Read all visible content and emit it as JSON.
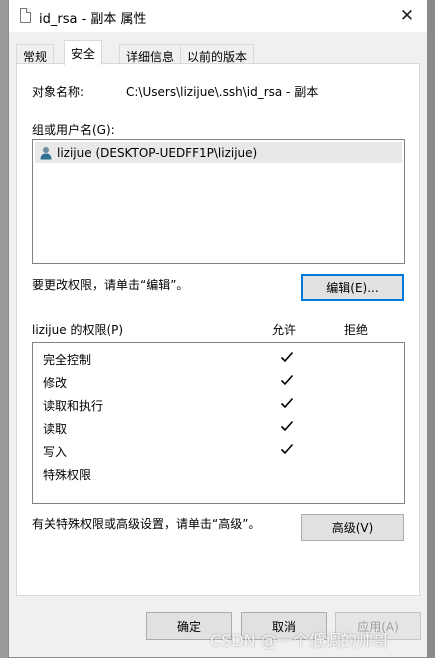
{
  "window": {
    "title": "id_rsa - 副本 属性",
    "close_glyph": "✕"
  },
  "tabs": [
    {
      "label": "常规",
      "active": false
    },
    {
      "label": "安全",
      "active": true
    },
    {
      "label": "详细信息",
      "active": false
    },
    {
      "label": "以前的版本",
      "active": false
    }
  ],
  "security": {
    "object_label": "对象名称:",
    "object_value": "C:\\Users\\lizijue\\.ssh\\id_rsa - 副本",
    "group_label": "组或用户名(G):",
    "users": [
      {
        "name": "lizijue (DESKTOP-UEDFF1P\\lizijue)",
        "icon": "user-icon",
        "selected": true
      }
    ],
    "change_hint": "要更改权限，请单击“编辑”。",
    "edit_button": "编辑(E)...",
    "perm_title": "lizijue 的权限(P)",
    "allow_header": "允许",
    "deny_header": "拒绝",
    "permissions": [
      {
        "name": "完全控制",
        "allow": true
      },
      {
        "name": "修改",
        "allow": true
      },
      {
        "name": "读取和执行",
        "allow": true
      },
      {
        "name": "读取",
        "allow": true
      },
      {
        "name": "写入",
        "allow": true
      },
      {
        "name": "特殊权限",
        "allow": false
      }
    ],
    "advanced_hint": "有关特殊权限或高级设置，请单击“高级”。",
    "advanced_button": "高级(V)"
  },
  "footer": {
    "ok": "确定",
    "cancel": "取消",
    "apply": "应用(A)"
  },
  "watermark": "CSDN @一个低调的帅哥",
  "colors": {
    "focus_border": "#0078d7",
    "button_bg": "#e1e1e1",
    "selection_bg": "#e8e8e8"
  }
}
